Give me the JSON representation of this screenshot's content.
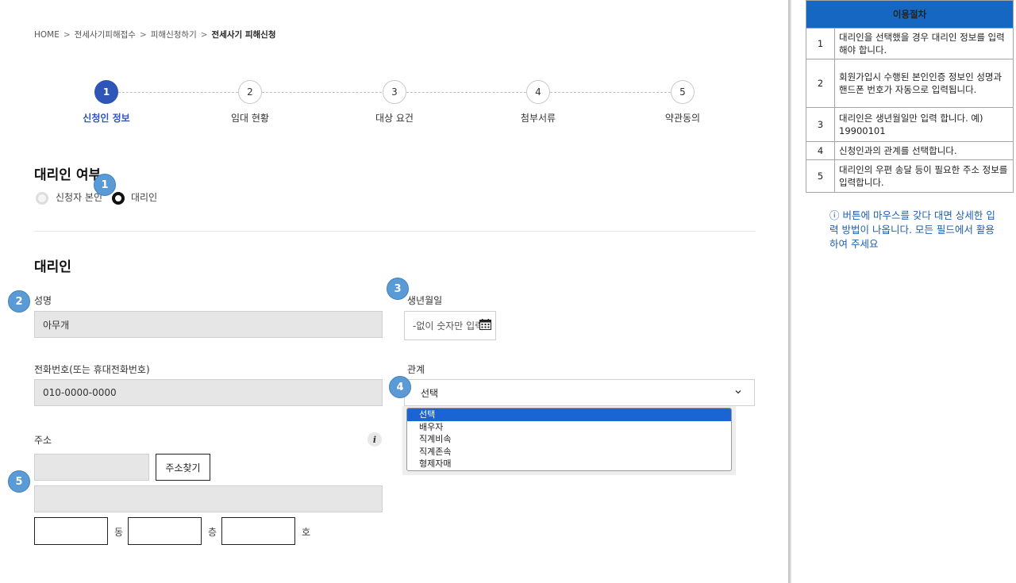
{
  "breadcrumb": [
    "HOME",
    "전세사기피해접수",
    "피해신청하기",
    "전세사기 피해신청"
  ],
  "steps": [
    {
      "num": "1",
      "label": "신청인 정보"
    },
    {
      "num": "2",
      "label": "임대 현황"
    },
    {
      "num": "3",
      "label": "대상 요건"
    },
    {
      "num": "4",
      "label": "첨부서류"
    },
    {
      "num": "5",
      "label": "약관동의"
    }
  ],
  "proxy_section": {
    "title": "대리인 여부",
    "options": [
      "신청자 본인",
      "대리인"
    ],
    "selected": "대리인"
  },
  "agent_section": {
    "title": "대리인",
    "name_label": "성명",
    "name_value": "아무개",
    "birth_label": "생년월일",
    "birth_placeholder": "-없이 숫자만 입력",
    "phone_label": "전화번호(또는 휴대전화번호)",
    "phone_value": "010-0000-0000",
    "relation_label": "관계",
    "relation_value": "선택",
    "relation_options": [
      "선택",
      "배우자",
      "직계비속",
      "직계존속",
      "형제자매"
    ],
    "address_label": "주소",
    "address_button": "주소찾기",
    "unit_dong": "동",
    "unit_floor": "층",
    "unit_ho": "호"
  },
  "badges": [
    "1",
    "2",
    "3",
    "4",
    "5"
  ],
  "side_panel": {
    "title": "이용절차",
    "rows": [
      {
        "num": "1",
        "text": "대리인을 선택했을 경우 대리인 정보를 입력해야 합니다."
      },
      {
        "num": "2",
        "text": "회원가입시 수행된 본인인증 정보인 성명과 핸드폰 번호가 자동으로 입력됩니다."
      },
      {
        "num": "3",
        "text": "대리인은 생년월일만 입력 합니다. 예) 19900101"
      },
      {
        "num": "4",
        "text": "신청인과의 관계를 선택합니다."
      },
      {
        "num": "5",
        "text": "대리인의 우편 송달 등이 필요한 주소 정보를 입력합니다."
      }
    ],
    "note": "ⓘ 버튼에 마우스를 갖다 대면 상세한 입력 방법이 나옵니다. 모든 필드에서 활용하여 주세요"
  },
  "colors": {
    "accent": "#2f55b7",
    "panel_header": "#1667c2",
    "badge": "#5b9bd5",
    "option_selected": "#1a64d4"
  }
}
